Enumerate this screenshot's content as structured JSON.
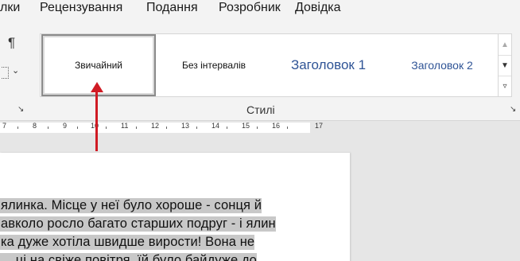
{
  "menubar": {
    "items": [
      "лки",
      "Рецензування",
      "Подання",
      "Розробник",
      "Довідка"
    ]
  },
  "ribbon": {
    "pilcrow": "¶",
    "chevron": "⌄",
    "launcher": "↘",
    "styles_gallery": {
      "items": [
        {
          "label": "Звичайний",
          "selected": true
        },
        {
          "label": "Без інтервалів",
          "selected": false
        },
        {
          "label": "Заголовок 1",
          "selected": false
        },
        {
          "label": "Заголовок 2",
          "selected": false
        }
      ],
      "scroll_up": "▲",
      "scroll_down": "▼",
      "more": "▿"
    },
    "group_label": "Стилі"
  },
  "ruler": {
    "numbers": [
      "7",
      "8",
      "9",
      "10",
      "11",
      "12",
      "13",
      "14",
      "15",
      "16",
      "17"
    ]
  },
  "document": {
    "lines": [
      "ялинка. Місце у неї було хороше - сонця й",
      "авколо росло багато старших подруг - і ялин",
      "ка дуже хотіла швидше вирости! Вона не",
      "... ці на свіже повітря, їй було байдуже до"
    ]
  },
  "annotation": {
    "arrow_color": "#d01b24"
  },
  "colors": {
    "heading": "#2f5496",
    "highlight": "#c8c8c8"
  }
}
